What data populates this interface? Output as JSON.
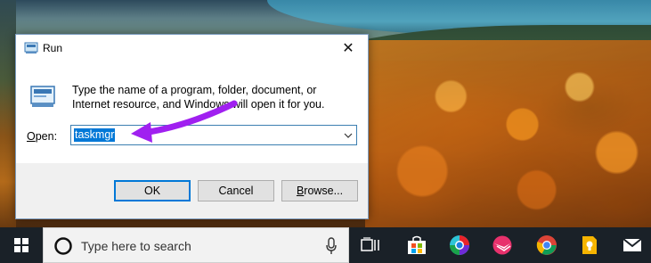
{
  "dialog": {
    "title": "Run",
    "description": "Type the name of a program, folder, document, or Internet resource, and Windows will open it for you.",
    "open_label_accel": "O",
    "open_label_rest": "pen:",
    "input_value": "taskmgr",
    "ok_label": "OK",
    "cancel_label": "Cancel",
    "browse_label_accel": "B",
    "browse_label_rest": "rowse..."
  },
  "taskbar": {
    "search_placeholder": "Type here to search",
    "pinned_icons": [
      "task-view-icon",
      "store-icon",
      "edge-dev-icon",
      "mail-app-icon",
      "chrome-icon",
      "keep-icon",
      "inbox-icon"
    ]
  },
  "colors": {
    "annotation_arrow": "#a020f0",
    "accent": "#0078d7"
  }
}
